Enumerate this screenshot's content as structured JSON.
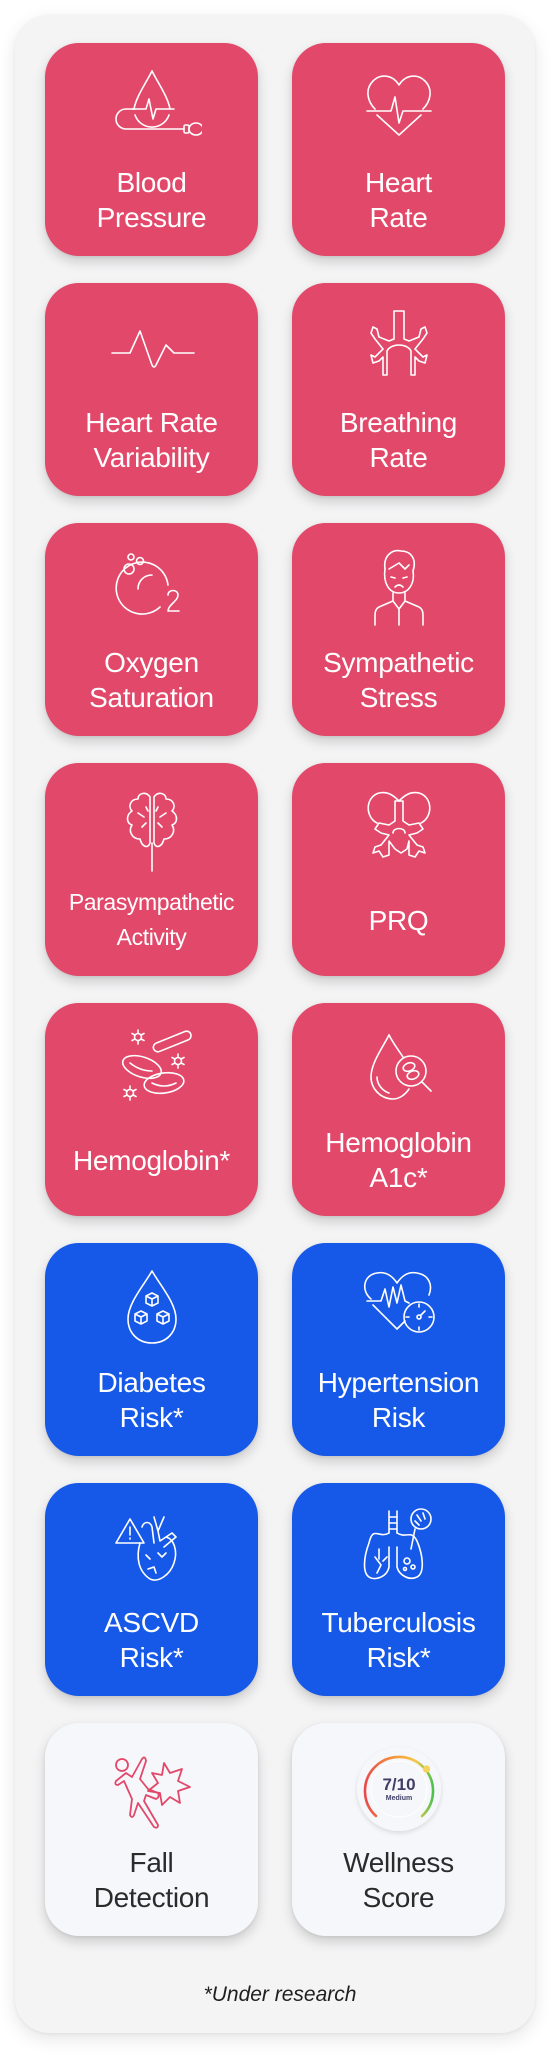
{
  "colors": {
    "panel_bg": "#f4f4f5",
    "vital_card": "#e2486a",
    "risk_card": "#1659e8",
    "feature_card": "#f6f7fb",
    "feature_icon": "#e2486a"
  },
  "cards": [
    {
      "id": "blood-pressure",
      "category": "vital",
      "icon": "blood-pressure-icon",
      "lines": [
        "Blood",
        "Pressure"
      ]
    },
    {
      "id": "heart-rate",
      "category": "vital",
      "icon": "heart-rate-icon",
      "lines": [
        "Heart",
        "Rate"
      ]
    },
    {
      "id": "heart-rate-variability",
      "category": "vital",
      "icon": "hrv-wave-icon",
      "lines": [
        "Heart Rate",
        "Variability"
      ]
    },
    {
      "id": "breathing-rate",
      "category": "vital",
      "icon": "lungs-bronchi-icon",
      "lines": [
        "Breathing",
        "Rate"
      ]
    },
    {
      "id": "oxygen-saturation",
      "category": "vital",
      "icon": "oxygen-o2-icon",
      "lines": [
        "Oxygen",
        "Saturation"
      ]
    },
    {
      "id": "sympathetic-stress",
      "category": "vital",
      "icon": "stressed-person-icon",
      "lines": [
        "Sympathetic",
        "Stress"
      ]
    },
    {
      "id": "parasympathetic-activity",
      "category": "vital",
      "icon": "brain-icon",
      "lines": [
        "Parasympathetic",
        "Activity"
      ]
    },
    {
      "id": "prq",
      "category": "vital",
      "icon": "heart-lungs-icon",
      "lines": [
        "PRQ"
      ]
    },
    {
      "id": "hemoglobin",
      "category": "vital",
      "icon": "blood-cells-icon",
      "lines": [
        "Hemoglobin*"
      ]
    },
    {
      "id": "hemoglobin-a1c",
      "category": "vital",
      "icon": "blood-drop-magnifier-icon",
      "lines": [
        "Hemoglobin",
        "A1c*"
      ]
    },
    {
      "id": "diabetes-risk",
      "category": "risk",
      "icon": "sugar-drop-icon",
      "lines": [
        "Diabetes",
        "Risk*"
      ]
    },
    {
      "id": "hypertension-risk",
      "category": "risk",
      "icon": "heart-gauge-icon",
      "lines": [
        "Hypertension",
        "Risk"
      ]
    },
    {
      "id": "ascvd-risk",
      "category": "risk",
      "icon": "heart-warning-icon",
      "lines": [
        "ASCVD",
        "Risk*"
      ]
    },
    {
      "id": "tuberculosis-risk",
      "category": "risk",
      "icon": "lungs-bacteria-icon",
      "lines": [
        "Tuberculosis",
        "Risk*"
      ]
    },
    {
      "id": "fall-detection",
      "category": "feature",
      "icon": "falling-person-icon",
      "lines": [
        "Fall",
        "Detection"
      ]
    },
    {
      "id": "wellness-score",
      "category": "feature",
      "icon": "wellness-gauge-icon",
      "lines": [
        "Wellness",
        "Score"
      ]
    }
  ],
  "wellness_gauge": {
    "score": "7/10",
    "level": "Medium",
    "value": 7,
    "max": 10
  },
  "footnote": "*Under research"
}
